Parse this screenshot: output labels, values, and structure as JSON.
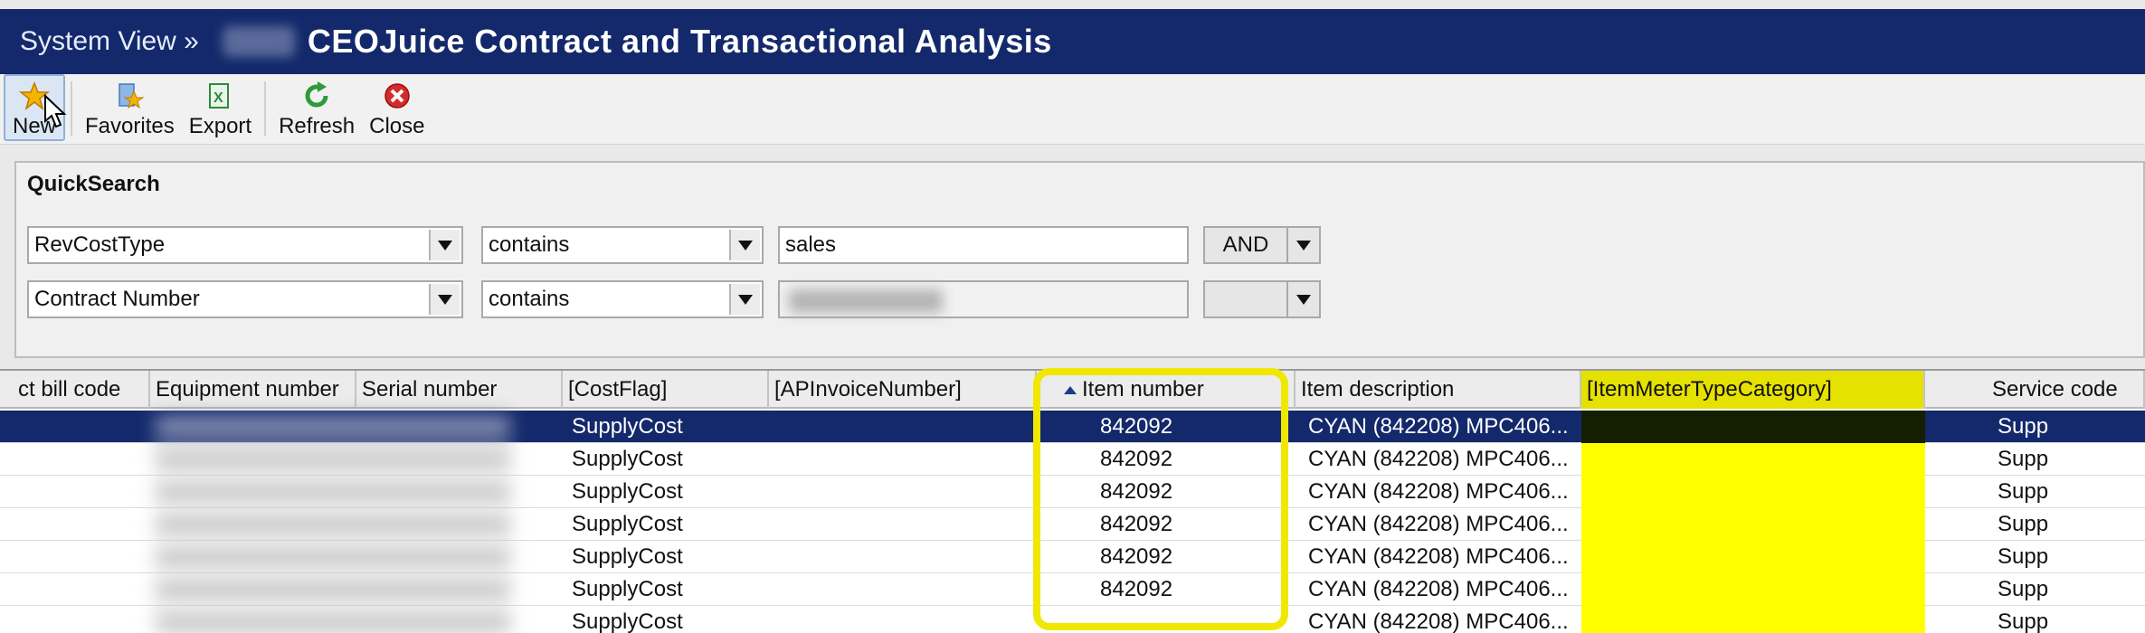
{
  "title_bar": {
    "breadcrumb": "System View »",
    "title": "CEOJuice Contract and Transactional Analysis"
  },
  "toolbar": {
    "buttons": [
      {
        "label": "New",
        "icon": "star-icon"
      },
      {
        "label": "Favorites",
        "icon": "favorites-icon"
      },
      {
        "label": "Export",
        "icon": "export-excel-icon"
      },
      {
        "label": "Refresh",
        "icon": "refresh-icon"
      },
      {
        "label": "Close",
        "icon": "close-icon"
      }
    ]
  },
  "quicksearch": {
    "title": "QuickSearch",
    "rows": [
      {
        "field": "RevCostType",
        "operator": "contains",
        "value": "sales",
        "logic": "AND"
      },
      {
        "field": "Contract Number",
        "operator": "contains",
        "value": "",
        "logic": ""
      }
    ]
  },
  "grid": {
    "columns": [
      {
        "label": "ct bill code"
      },
      {
        "label": "Equipment number"
      },
      {
        "label": "Serial number"
      },
      {
        "label": "[CostFlag]"
      },
      {
        "label": "[APInvoiceNumber]"
      },
      {
        "label": "Item number"
      },
      {
        "label": "Item description"
      },
      {
        "label": "[ItemMeterTypeCategory]"
      },
      {
        "label": "Service code"
      }
    ],
    "rows": [
      {
        "cost_flag": "SupplyCost",
        "item_number": "842092",
        "item_description": "CYAN (842208) MPC406...",
        "service_code": "Supp"
      },
      {
        "cost_flag": "SupplyCost",
        "item_number": "842092",
        "item_description": "CYAN (842208) MPC406...",
        "service_code": "Supp"
      },
      {
        "cost_flag": "SupplyCost",
        "item_number": "842092",
        "item_description": "CYAN (842208) MPC406...",
        "service_code": "Supp"
      },
      {
        "cost_flag": "SupplyCost",
        "item_number": "842092",
        "item_description": "CYAN (842208) MPC406...",
        "service_code": "Supp"
      },
      {
        "cost_flag": "SupplyCost",
        "item_number": "842092",
        "item_description": "CYAN (842208) MPC406...",
        "service_code": "Supp"
      },
      {
        "cost_flag": "SupplyCost",
        "item_number": "842092",
        "item_description": "CYAN (842208) MPC406...",
        "service_code": "Supp"
      },
      {
        "cost_flag": "SupplyCost",
        "item_number": "",
        "item_description": "CYAN (842208) MPC406...",
        "service_code": "Supp"
      }
    ],
    "selected_row": 0
  },
  "colors": {
    "title_bar": "#13296b",
    "highlight": "#ffff00",
    "annotation_box": "#f0e800"
  }
}
